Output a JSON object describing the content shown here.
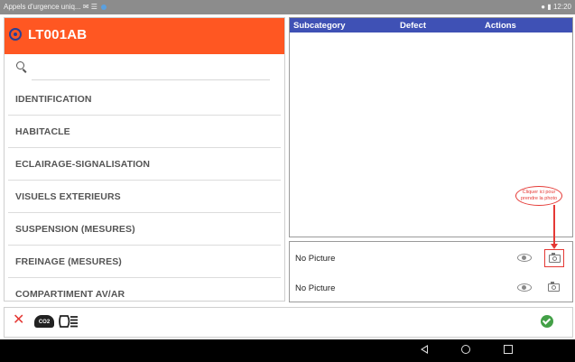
{
  "status_bar": {
    "notification_text": "Appels d'urgence uniq...",
    "time": "12:20"
  },
  "vehicle": {
    "plate": "LT001AB"
  },
  "search": {
    "placeholder": "",
    "value": ""
  },
  "categories": [
    "IDENTIFICATION",
    "HABITACLE",
    "ECLAIRAGE-SIGNALISATION",
    "VISUELS EXTERIEURS",
    "SUSPENSION (MESURES)",
    "FREINAGE (MESURES)",
    "COMPARTIMENT AV/AR"
  ],
  "defects_table": {
    "columns": [
      "Subcategory",
      "Defect",
      "Actions"
    ],
    "rows": []
  },
  "pictures": [
    {
      "label": "No Picture"
    },
    {
      "label": "No Picture"
    }
  ],
  "annotation": {
    "text": "Cliquer ici pour prendre la photo"
  },
  "toolbar": {
    "co2_label": "CO2"
  },
  "colors": {
    "header_orange": "#ff5722",
    "table_header_blue": "#3f51b5",
    "confirm_green": "#43a047",
    "annotation_red": "#e53935"
  },
  "icons": [
    "search-icon",
    "eye-icon",
    "camera-icon",
    "close-icon",
    "co2-cloud-icon",
    "headlight-icon",
    "check-icon"
  ]
}
